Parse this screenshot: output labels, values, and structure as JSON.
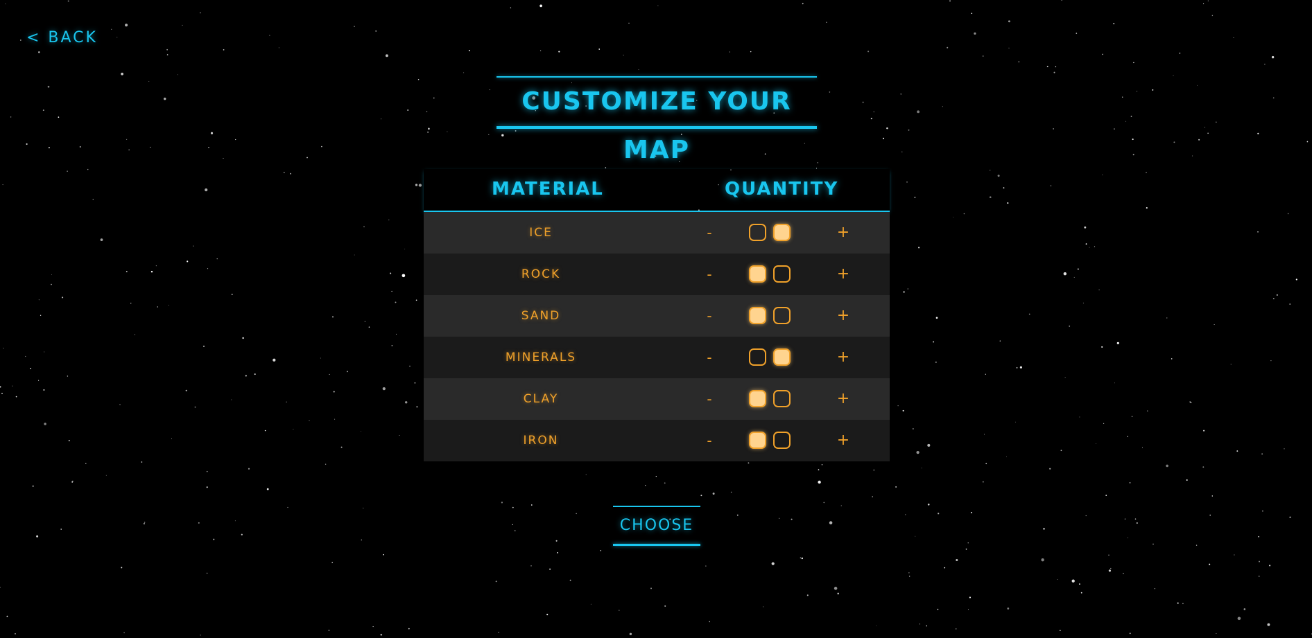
{
  "nav": {
    "back_label": "< BACK"
  },
  "header": {
    "title": "CUSTOMIZE YOUR MAP"
  },
  "table": {
    "columns": {
      "material": "MATERIAL",
      "quantity": "QUANTITY"
    },
    "minus_symbol": "-",
    "plus_symbol": "+",
    "rows": [
      {
        "name": "ICE",
        "quantity": 2
      },
      {
        "name": "ROCK",
        "quantity": 1
      },
      {
        "name": "SAND",
        "quantity": 1
      },
      {
        "name": "MINERALS",
        "quantity": 2
      },
      {
        "name": "CLAY",
        "quantity": 1
      },
      {
        "name": "IRON",
        "quantity": 1
      }
    ]
  },
  "footer": {
    "choose_label": "CHOOSE"
  },
  "colors": {
    "accent_cyan": "#19c6ef",
    "accent_orange": "#f0a12a",
    "filled_box": "#ffd48f",
    "row_light": "#2a2a2a",
    "row_dark": "#1b1b1b",
    "background": "#000000"
  }
}
